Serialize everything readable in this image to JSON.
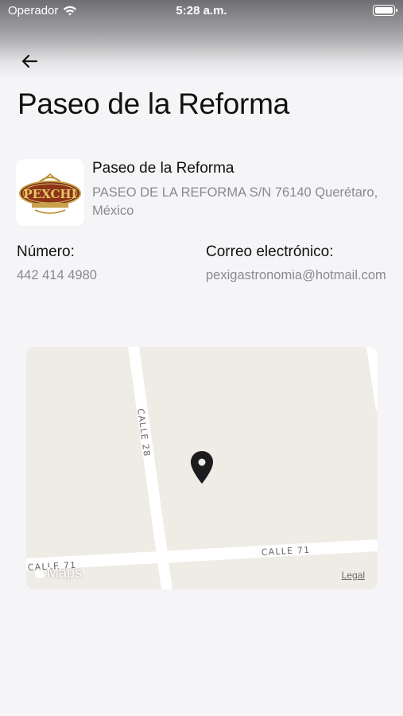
{
  "status_bar": {
    "carrier": "Operador",
    "time": "5:28 a.m."
  },
  "page": {
    "title": "Paseo de la Reforma"
  },
  "place": {
    "logo_text": "PEXCHI",
    "name": "Paseo de la Reforma",
    "address": "PASEO DE LA REFORMA S/N 76140 Querétaro, México"
  },
  "contact": {
    "number_label": "Número:",
    "number_value": "442 414 4980",
    "email_label": "Correo electrónico:",
    "email_value": "pexigastronomia@hotmail.com"
  },
  "map": {
    "street_1": "CALLE 28",
    "street_2": "CALLE 71",
    "street_3": "CALLE 71",
    "maps_brand": "Maps",
    "legal": "Legal"
  },
  "icons": {
    "back": "arrow-left-icon",
    "pin": "map-pin-icon",
    "wifi": "wifi-icon",
    "battery": "battery-icon"
  }
}
